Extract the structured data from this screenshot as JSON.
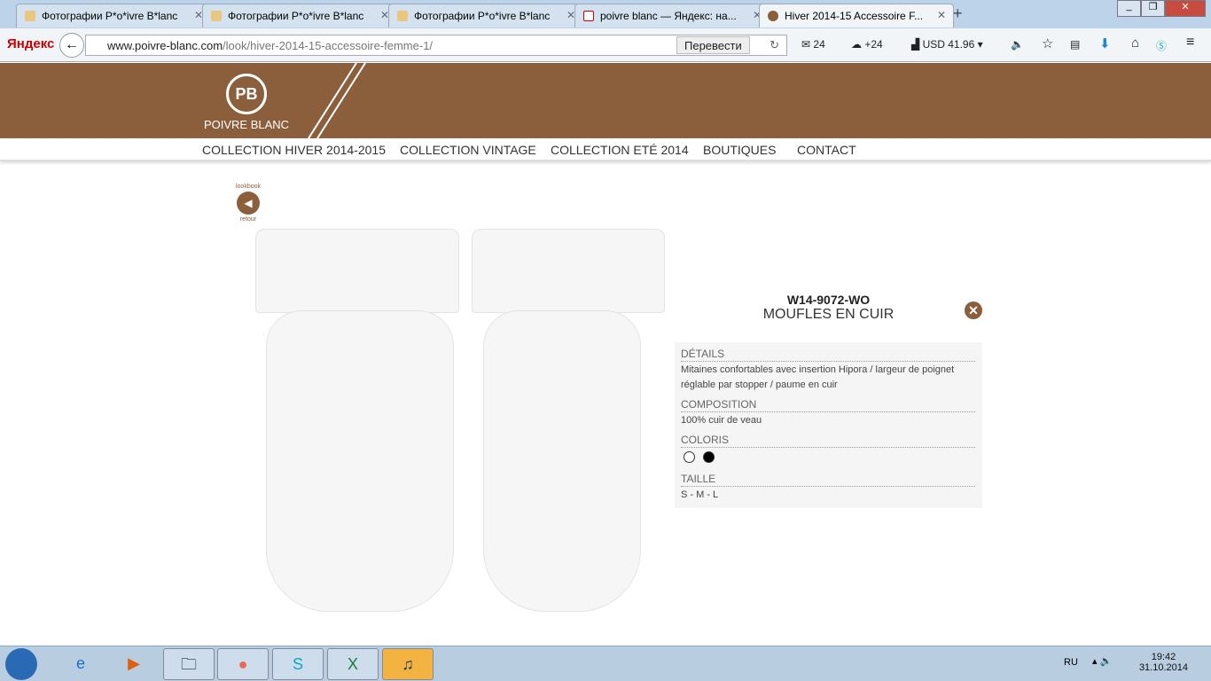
{
  "browser": {
    "tabs": [
      {
        "label": "Фотографии P*o*ivre B*lanc"
      },
      {
        "label": "Фотографии P*o*ivre B*lanc"
      },
      {
        "label": "Фотографии P*o*ivre B*lanc"
      },
      {
        "label": "poivre blanc — Яндекс: на..."
      },
      {
        "label": "Hiver 2014-15 Accessoire F..."
      }
    ],
    "search_brand": "Яндекс",
    "url_domain": "www.poivre-blanc.com",
    "url_path": "/look/hiver-2014-15-accessoire-femme-1/",
    "translate_label": "Перевести",
    "mail_count": "24",
    "weather": "+24",
    "currency": "USD 41.96"
  },
  "site": {
    "logo_initials": "PB",
    "logo_name": "POIVRE BLANC",
    "menu": [
      "COLLECTION HIVER 2014-2015",
      "COLLECTION VINTAGE",
      "COLLECTION ETÉ 2014",
      "BOUTIQUES",
      "CONTACT"
    ],
    "lookbook_top": "lookbook",
    "lookbook_bottom": "retour"
  },
  "product": {
    "code": "W14-9072-WO",
    "name": "MOUFLES EN CUIR",
    "details_label": "DÉTAILS",
    "details": "Mitaines confortables avec insertion Hipora / largeur de poignet réglable par stopper / paume en cuir",
    "composition_label": "COMPOSITION",
    "composition": "100% cuir de veau",
    "colors_label": "COLORIS",
    "colors": [
      "#ffffff",
      "#000000"
    ],
    "size_label": "TAILLE",
    "sizes": "S - M - L"
  },
  "taskbar": {
    "lang": "RU",
    "time": "19:42",
    "date": "31.10.2014"
  }
}
